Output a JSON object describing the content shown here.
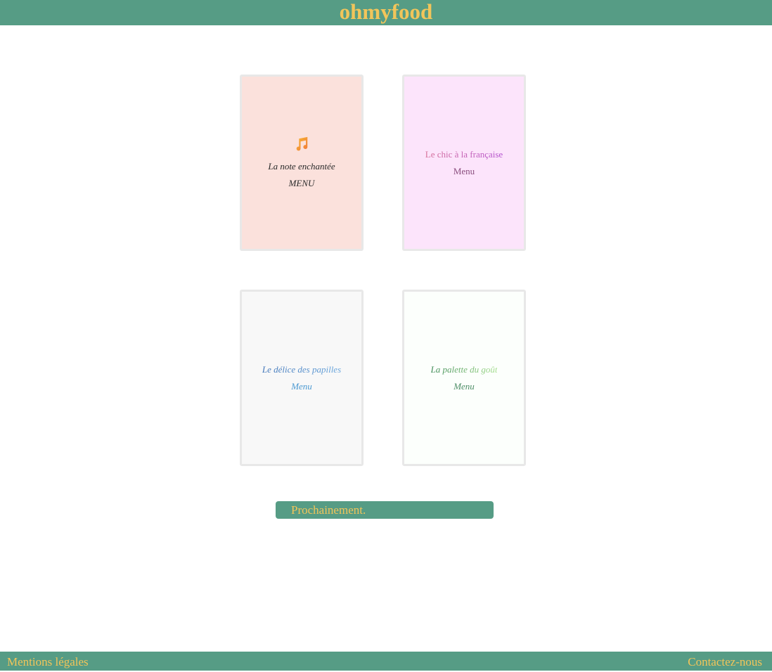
{
  "header": {
    "brand": "ohmyfood"
  },
  "restaurants": [
    {
      "title": "La note enchantée",
      "link": "MENU",
      "icon": "music-note-icon"
    },
    {
      "title": "Le chic à la française",
      "link": "Menu"
    },
    {
      "title": "Le délice des papilles",
      "link": "Menu"
    },
    {
      "title": "La palette du goût",
      "link": "Menu"
    }
  ],
  "banner": {
    "text": "Prochainement."
  },
  "footer": {
    "legal": "Mentions légales",
    "contact": "Contactez-nous"
  },
  "colors": {
    "primary": "#569c85",
    "accent": "#f2c55a",
    "card1_bg": "#fbe1dc",
    "card2_bg": "#fce4fb",
    "card3_bg": "#f8f8f8",
    "card4_bg": "#fcfffc"
  }
}
